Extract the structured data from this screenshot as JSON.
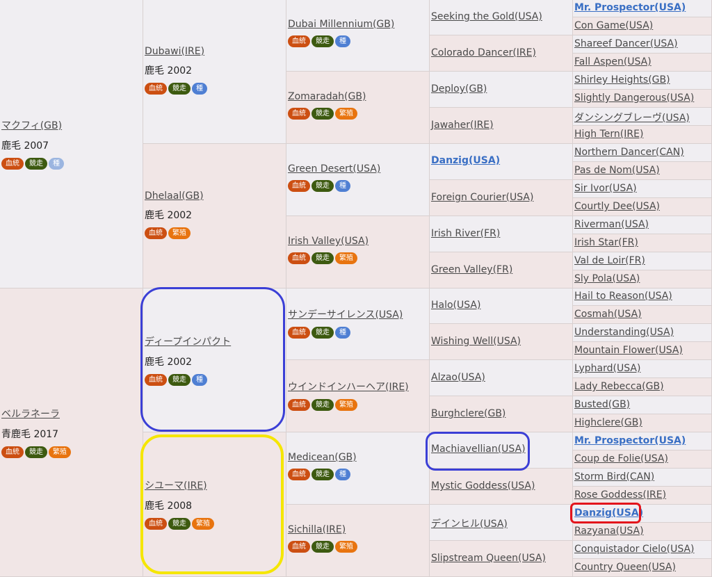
{
  "badges": {
    "ketto": "血統",
    "kyoso": "競走",
    "tane": "種",
    "hanshoku": "繁殖"
  },
  "gen1": [
    {
      "name": "マクフィ(GB)",
      "info": "鹿毛 2007"
    },
    {
      "name": "ベルラネーラ",
      "info": "青鹿毛 2017"
    }
  ],
  "gen2": [
    {
      "name": "Dubawi(IRE)",
      "info": "鹿毛 2002"
    },
    {
      "name": "Dhelaal(GB)",
      "info": "鹿毛 2002"
    },
    {
      "name": "ディープインパクト",
      "info": "鹿毛 2002"
    },
    {
      "name": "シユーマ(IRE)",
      "info": "鹿毛 2008"
    }
  ],
  "gen3": [
    {
      "name": "Dubai Millennium(GB)"
    },
    {
      "name": "Zomaradah(GB)"
    },
    {
      "name": "Green Desert(USA)"
    },
    {
      "name": "Irish Valley(USA)"
    },
    {
      "name": "サンデーサイレンス(USA)"
    },
    {
      "name": "ウインドインハーヘア(IRE)"
    },
    {
      "name": "Medicean(GB)"
    },
    {
      "name": "Sichilla(IRE)"
    }
  ],
  "gen4": [
    {
      "name": "Seeking the Gold(USA)"
    },
    {
      "name": "Colorado Dancer(IRE)"
    },
    {
      "name": "Deploy(GB)"
    },
    {
      "name": "Jawaher(IRE)"
    },
    {
      "name": "Danzig(USA)"
    },
    {
      "name": "Foreign Courier(USA)"
    },
    {
      "name": "Irish River(FR)"
    },
    {
      "name": "Green Valley(FR)"
    },
    {
      "name": "Halo(USA)"
    },
    {
      "name": "Wishing Well(USA)"
    },
    {
      "name": "Alzao(USA)"
    },
    {
      "name": "Burghclere(GB)"
    },
    {
      "name": "Machiavellian(USA)"
    },
    {
      "name": "Mystic Goddess(USA)"
    },
    {
      "name": "デインヒル(USA)"
    },
    {
      "name": "Slipstream Queen(USA)"
    }
  ],
  "gen5": [
    {
      "name": "Mr. Prospector(USA)"
    },
    {
      "name": "Con Game(USA)"
    },
    {
      "name": "Shareef Dancer(USA)"
    },
    {
      "name": "Fall Aspen(USA)"
    },
    {
      "name": "Shirley Heights(GB)"
    },
    {
      "name": "Slightly Dangerous(USA)"
    },
    {
      "name": "ダンシングブレーヴ(USA)"
    },
    {
      "name": "High Tern(IRE)"
    },
    {
      "name": "Northern Dancer(CAN)"
    },
    {
      "name": "Pas de Nom(USA)"
    },
    {
      "name": "Sir Ivor(USA)"
    },
    {
      "name": "Courtly Dee(USA)"
    },
    {
      "name": "Riverman(USA)"
    },
    {
      "name": "Irish Star(FR)"
    },
    {
      "name": "Val de Loir(FR)"
    },
    {
      "name": "Sly Pola(USA)"
    },
    {
      "name": "Hail to Reason(USA)"
    },
    {
      "name": "Cosmah(USA)"
    },
    {
      "name": "Understanding(USA)"
    },
    {
      "name": "Mountain Flower(USA)"
    },
    {
      "name": "Lyphard(USA)"
    },
    {
      "name": "Lady Rebecca(GB)"
    },
    {
      "name": "Busted(GB)"
    },
    {
      "name": "Highclere(GB)"
    },
    {
      "name": "Mr. Prospector(USA)"
    },
    {
      "name": "Coup de Folie(USA)"
    },
    {
      "name": "Storm Bird(CAN)"
    },
    {
      "name": "Rose Goddess(IRE)"
    },
    {
      "name": "Danzig(USA)"
    },
    {
      "name": "Razyana(USA)"
    },
    {
      "name": "Conquistador Cielo(USA)"
    },
    {
      "name": "Country Queen(USA)"
    }
  ],
  "colors": {
    "blue_ring": "#3b3fd6",
    "yellow_ring": "#f5e600",
    "red_ring": "#e3141b",
    "highlight_name": "#3a6fc4"
  }
}
